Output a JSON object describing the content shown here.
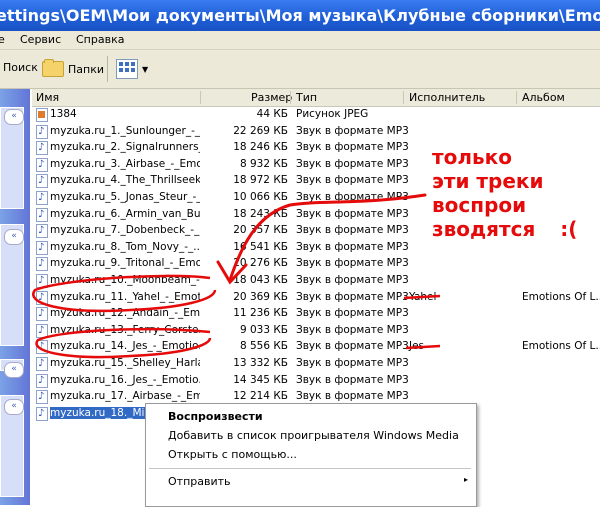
{
  "window": {
    "title": "ettings\\OEM\\Мои документы\\Моя музыка\\Клубные сборники\\Emotions"
  },
  "menu": {
    "items": [
      "е",
      "Сервис",
      "Справка"
    ]
  },
  "toolbar": {
    "search_label": "Поиск",
    "folders_label": "Папки"
  },
  "columns": {
    "name": "Имя",
    "size": "Размер",
    "type": "Тип",
    "artist": "Исполнитель",
    "album": "Альбом"
  },
  "files": [
    {
      "name": "1384",
      "size": "44 КБ",
      "type": "Рисунок JPEG",
      "artist": "",
      "album": "",
      "icon": "jpeg-file-icon"
    },
    {
      "name": "myzuka.ru_1._Sunlounger_-_...",
      "size": "22 269 КБ",
      "type": "Звук в формате MP3",
      "artist": "",
      "album": "",
      "icon": "mp3-file-icon"
    },
    {
      "name": "myzuka.ru_2._Signalrunners_...",
      "size": "18 246 КБ",
      "type": "Звук в формате MP3",
      "artist": "",
      "album": "",
      "icon": "mp3-file-icon"
    },
    {
      "name": "myzuka.ru_3._Airbase_-_Emo...",
      "size": "8 932 КБ",
      "type": "Звук в формате MP3",
      "artist": "",
      "album": "",
      "icon": "mp3-file-icon"
    },
    {
      "name": "myzuka.ru_4._The_Thrillseek...",
      "size": "18 972 КБ",
      "type": "Звук в формате MP3",
      "artist": "",
      "album": "",
      "icon": "mp3-file-icon"
    },
    {
      "name": "myzuka.ru_5._Jonas_Steur_-_...",
      "size": "10 066 КБ",
      "type": "Звук в формате MP3",
      "artist": "",
      "album": "",
      "icon": "mp3-file-icon"
    },
    {
      "name": "myzuka.ru_6._Armin_van_Bu...",
      "size": "18 243 КБ",
      "type": "Звук в формате MP3",
      "artist": "",
      "album": "",
      "icon": "mp3-file-icon"
    },
    {
      "name": "myzuka.ru_7._Dobenbeck_-_...",
      "size": "20 357 КБ",
      "type": "Звук в формате MP3",
      "artist": "",
      "album": "",
      "icon": "mp3-file-icon"
    },
    {
      "name": "myzuka.ru_8._Tom_Novy_-_...",
      "size": "16 541 КБ",
      "type": "Звук в формате MP3",
      "artist": "",
      "album": "",
      "icon": "mp3-file-icon"
    },
    {
      "name": "myzuka.ru_9._Tritonal_-_Emo...",
      "size": "20 276 КБ",
      "type": "Звук в формате MP3",
      "artist": "",
      "album": "",
      "icon": "mp3-file-icon"
    },
    {
      "name": "myzuka.ru_10._Moonbeam_-...",
      "size": "18 043 КБ",
      "type": "Звук в формате MP3",
      "artist": "",
      "album": "",
      "icon": "mp3-file-icon"
    },
    {
      "name": "myzuka.ru_11._Yahel_-_Emot...",
      "size": "20 369 КБ",
      "type": "Звук в формате MP3",
      "artist": "Yahel",
      "album": "Emotions Of L...",
      "icon": "mp3-file-icon"
    },
    {
      "name": "myzuka.ru_12._Andain_-_Em...",
      "size": "11 236 КБ",
      "type": "Звук в формате MP3",
      "artist": "",
      "album": "",
      "icon": "mp3-file-icon"
    },
    {
      "name": "myzuka.ru_13._Ferry_Corste...",
      "size": "9 033 КБ",
      "type": "Звук в формате MP3",
      "artist": "",
      "album": "",
      "icon": "mp3-file-icon"
    },
    {
      "name": "myzuka.ru_14._Jes_-_Emotio...",
      "size": "8 556 КБ",
      "type": "Звук в формате MP3",
      "artist": "Jes",
      "album": "Emotions Of L...",
      "icon": "mp3-file-icon"
    },
    {
      "name": "myzuka.ru_15._Shelley_Harla...",
      "size": "13 332 КБ",
      "type": "Звук в формате MP3",
      "artist": "",
      "album": "",
      "icon": "mp3-file-icon"
    },
    {
      "name": "myzuka.ru_16._Jes_-_Emotio...",
      "size": "14 345 КБ",
      "type": "Звук в формате MP3",
      "artist": "",
      "album": "",
      "icon": "mp3-file-icon"
    },
    {
      "name": "myzuka.ru_17._Airbase_-_Em...",
      "size": "12 214 КБ",
      "type": "Звук в формате MP3",
      "artist": "",
      "album": "",
      "icon": "mp3-file-icon"
    },
    {
      "name": "myzuka.ru_18._Mike_Oldfield...",
      "size": "",
      "type": "",
      "artist": "",
      "album": "",
      "icon": "mp3-file-icon",
      "selected": true
    }
  ],
  "context_menu": {
    "play": "Воспроизвести",
    "add": "Добавить в список проигрывателя Windows Media",
    "open_with": "Открыть с помощью...",
    "send_to": "Отправить",
    "submenu_arrow": "▸"
  },
  "annotation": {
    "line1": "только",
    "line2": "эти треки",
    "line3": "воспрои",
    "line4": "зводятся",
    "face": ":(",
    "color": "#e50b0b"
  }
}
